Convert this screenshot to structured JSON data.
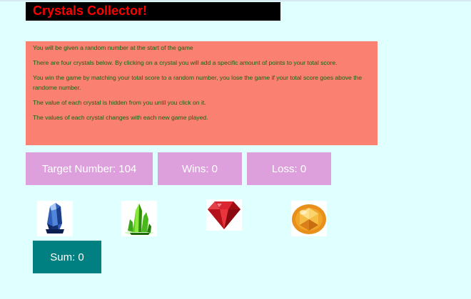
{
  "header": {
    "title": "Crystals Collector!"
  },
  "instructions": [
    "You will be given a random number at the start of the game",
    "There are four crystals below. By clicking on a crystal you will add a specific amount of points to your total score.",
    "You win the game by matching your total score to a random number, you lose the game if your total score goes above the randome number.",
    "The value of each crystal is hidden from you until you click on it.",
    "The values of each crystal changes with each new game played."
  ],
  "stats": {
    "target_text": "Target Number: 104",
    "wins_text": "Wins: 0",
    "loss_text": "Loss: 0"
  },
  "crystals": [
    {
      "icon": "blue-crystal-icon"
    },
    {
      "icon": "green-crystal-icon"
    },
    {
      "icon": "red-gem-icon"
    },
    {
      "icon": "orange-gem-icon"
    }
  ],
  "sum": {
    "text": "Sum: 0"
  },
  "colors": {
    "page_background": "#e0ffff",
    "title_background": "#000000",
    "title_text": "#ff0000",
    "instructions_background": "#fa8072",
    "instructions_text": "#146414",
    "stat_background": "#dda0dd",
    "sum_background": "#008080"
  }
}
